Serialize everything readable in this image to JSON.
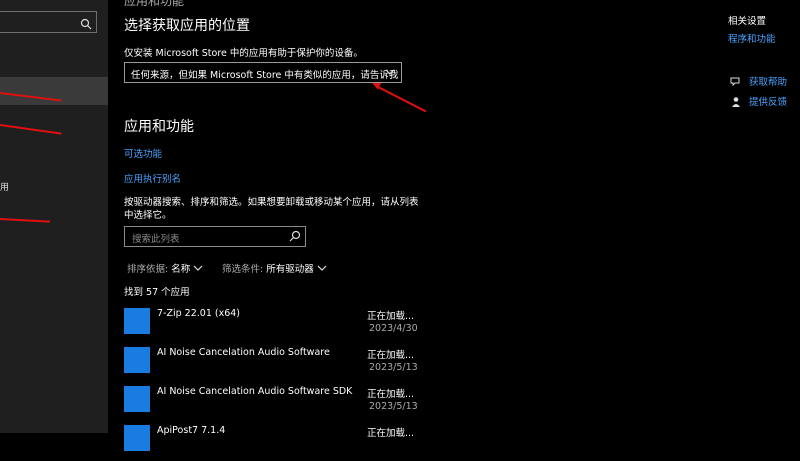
{
  "top_fragment": "应用和功能",
  "choose": {
    "title": "选择获取应用的位置",
    "description": "仅安装 Microsoft Store 中的应用有助于保护你的设备。",
    "dropdown_value": "任何来源，但如果 Microsoft Store 中有类似的应用，请告诉我"
  },
  "apps_section": {
    "title": "应用和功能",
    "optional_features": "可选功能",
    "app_aliases": "应用执行别名",
    "search_help": "按驱动器搜索、排序和筛选。如果想要卸载或移动某个应用，请从列表中选择它。",
    "search_placeholder": "搜索此列表",
    "sort_label": "排序依据:",
    "sort_value": "名称",
    "filter_label": "筛选条件:",
    "filter_value": "所有驱动器",
    "found": "找到 57 个应用"
  },
  "apps": [
    {
      "name": "7-Zip 22.01 (x64)",
      "status": "正在加载...",
      "date": "2023/4/30"
    },
    {
      "name": "AI Noise Cancelation Audio Software",
      "status": "正在加载...",
      "date": "2023/5/13"
    },
    {
      "name": "AI Noise Cancelation Audio Software SDK",
      "status": "正在加载...",
      "date": "2023/5/13"
    },
    {
      "name": "ApiPost7 7.1.4",
      "status": "正在加载...",
      "date": ""
    }
  ],
  "sidebar": {
    "fragment": "用"
  },
  "related": {
    "title": "相关设置",
    "programs_features": "程序和功能",
    "get_help": "获取帮助",
    "feedback": "提供反馈"
  },
  "colors": {
    "accent": "#4aa2ff",
    "app_icon": "#1a7be0",
    "annotation_arrow": "#e01010"
  }
}
